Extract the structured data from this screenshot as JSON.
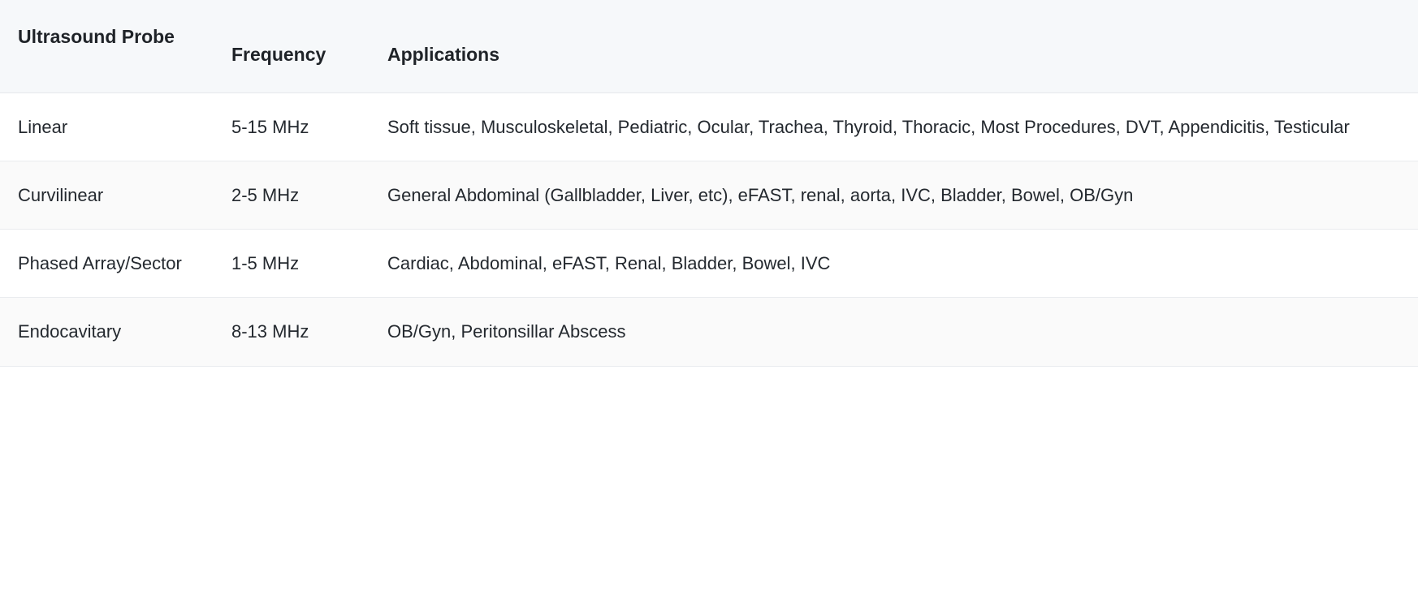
{
  "table": {
    "columns": [
      {
        "key": "probe",
        "label": "Ultrasound Probe"
      },
      {
        "key": "frequency",
        "label": "Frequency"
      },
      {
        "key": "applications",
        "label": "Applications"
      }
    ],
    "rows": [
      {
        "probe": "Linear",
        "frequency": "5-15 MHz",
        "applications": "Soft tissue, Musculoskeletal, Pediatric, Ocular, Trachea, Thyroid, Thoracic, Most Procedures, DVT, Appendicitis, Testicular"
      },
      {
        "probe": "Curvilinear",
        "frequency": "2-5 MHz",
        "applications": "General Abdominal (Gallbladder, Liver, etc), eFAST, renal, aorta, IVC, Bladder, Bowel, OB/Gyn"
      },
      {
        "probe": "Phased Array/Sector",
        "frequency": "1-5 MHz",
        "applications": "Cardiac, Abdominal, eFAST, Renal, Bladder, Bowel, IVC"
      },
      {
        "probe": "Endocavitary",
        "frequency": "8-13 MHz",
        "applications": "OB/Gyn, Peritonsillar Abscess"
      }
    ]
  },
  "colors": {
    "header_background": "#f6f8fa",
    "stripe_background": "#fafafa",
    "row_background": "#ffffff",
    "border": "#e6e8eb",
    "text": "#24292f",
    "header_text": "#1f2328"
  }
}
